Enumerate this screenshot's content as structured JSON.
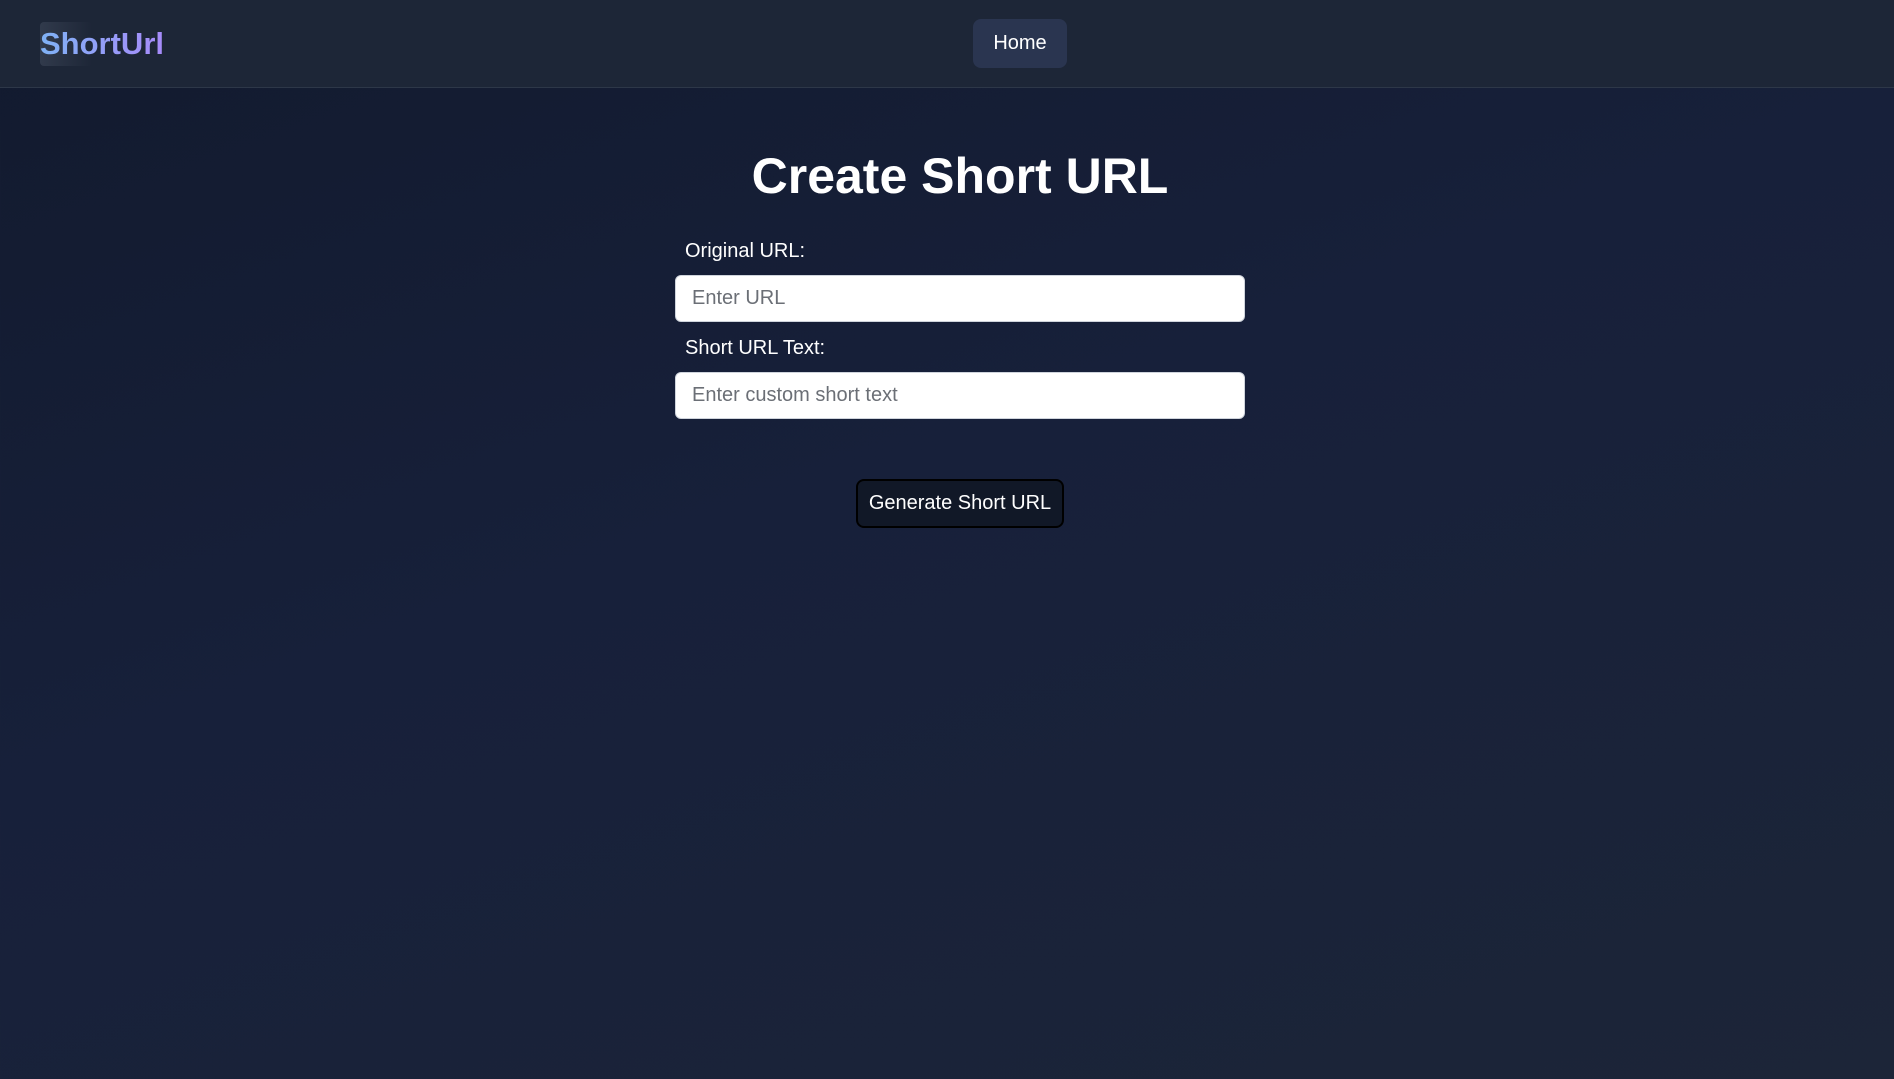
{
  "navbar": {
    "brand": "ShortUrl",
    "home_label": "Home"
  },
  "main": {
    "title": "Create Short URL",
    "original_url": {
      "label": "Original URL:",
      "placeholder": "Enter URL",
      "value": ""
    },
    "short_text": {
      "label": "Short URL Text:",
      "placeholder": "Enter custom short text",
      "value": ""
    },
    "generate_label": "Generate Short URL"
  },
  "colors": {
    "background": "#141c2f",
    "navbar": "#1d2637",
    "home_button": "#2a3550",
    "brand_gradient_start": "#7fb2f5",
    "brand_gradient_end": "#a78bfa",
    "generate_button": "#111827"
  }
}
